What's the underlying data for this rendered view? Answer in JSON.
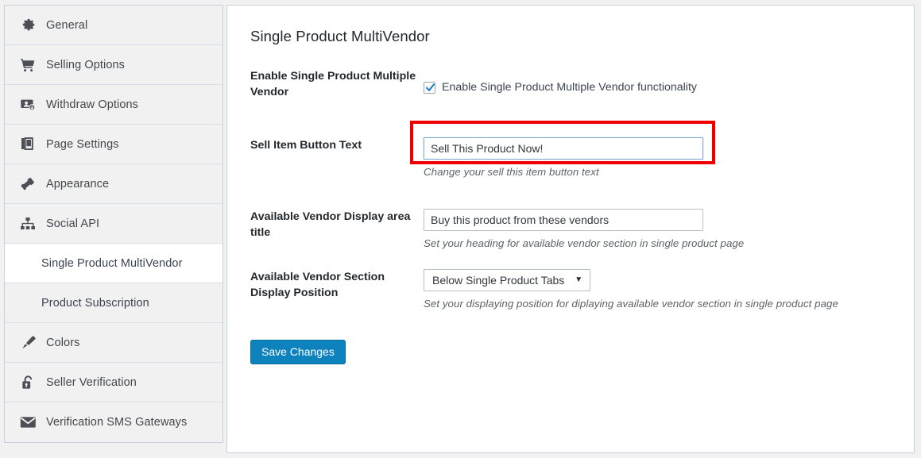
{
  "sidebar": {
    "items": [
      {
        "label": "General",
        "icon": "gear-icon",
        "sub": false,
        "active": false
      },
      {
        "label": "Selling Options",
        "icon": "cart-icon",
        "sub": false,
        "active": false
      },
      {
        "label": "Withdraw Options",
        "icon": "withdraw-icon",
        "sub": false,
        "active": false
      },
      {
        "label": "Page Settings",
        "icon": "book-icon",
        "sub": false,
        "active": false
      },
      {
        "label": "Appearance",
        "icon": "hammer-icon",
        "sub": false,
        "active": false
      },
      {
        "label": "Social API",
        "icon": "sitemap-icon",
        "sub": false,
        "active": false
      },
      {
        "label": "Single Product MultiVendor",
        "icon": "",
        "sub": true,
        "active": true
      },
      {
        "label": "Product Subscription",
        "icon": "",
        "sub": true,
        "active": false
      },
      {
        "label": "Colors",
        "icon": "brush-icon",
        "sub": false,
        "active": false
      },
      {
        "label": "Seller Verification",
        "icon": "unlock-icon",
        "sub": false,
        "active": false
      },
      {
        "label": "Verification SMS Gateways",
        "icon": "envelope-icon",
        "sub": false,
        "active": false
      }
    ]
  },
  "main": {
    "title": "Single Product MultiVendor",
    "rows": {
      "enable": {
        "label": "Enable Single Product Multiple Vendor",
        "checkbox_label": "Enable Single Product Multiple Vendor functionality",
        "checked": "true"
      },
      "sell_item": {
        "label": "Sell Item Button Text",
        "value": "Sell This Product Now!",
        "placeholder": "Sell This Product Now!",
        "description": "Change your sell this item button text"
      },
      "vendor_title": {
        "label": "Available Vendor Display area title",
        "value": "Buy this product from these vendors",
        "placeholder": "Buy this product from these vendors",
        "description": "Set your heading for available vendor section in single product page"
      },
      "display_position": {
        "label": "Available Vendor Section Display Position",
        "selected": "Below Single Product Tabs",
        "caret": "▼",
        "description": "Set your displaying position for diplaying available vendor section in single product page"
      }
    },
    "save_label": "Save Changes"
  },
  "annotation": {
    "highlight_color": "#ee0000"
  },
  "colors": {
    "accent": "#0d82bd",
    "panel_border": "#c6d3de",
    "sidebar_bg": "#f1f1f1",
    "text": "#23282d"
  }
}
